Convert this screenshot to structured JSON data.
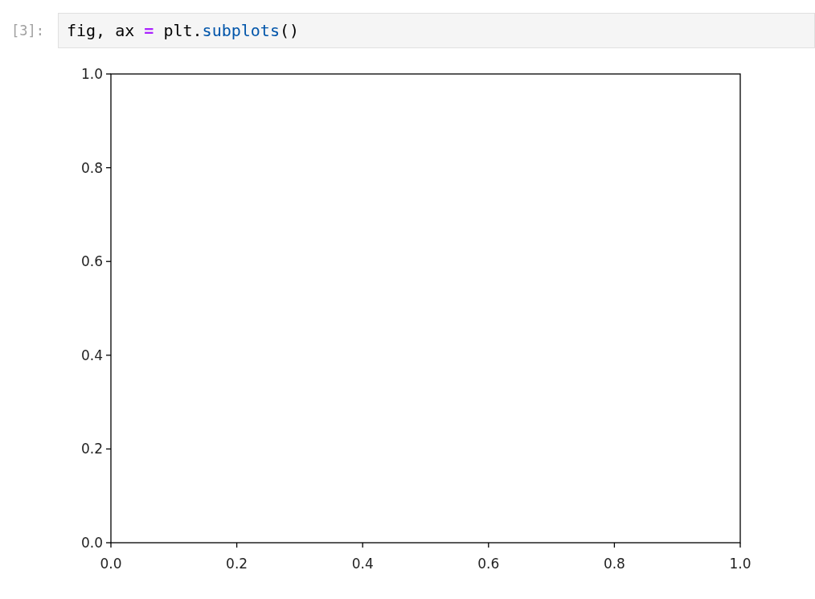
{
  "cell": {
    "prompt": "[3]:",
    "code": [
      {
        "text": "fig, ax ",
        "kind": "plain"
      },
      {
        "text": "=",
        "kind": "operator"
      },
      {
        "text": " plt.",
        "kind": "plain"
      },
      {
        "text": "subplots",
        "kind": "function"
      },
      {
        "text": "()",
        "kind": "plain"
      }
    ]
  },
  "output": {
    "chart_data": {
      "type": "line",
      "xlim": [
        0,
        1
      ],
      "ylim": [
        0,
        1
      ],
      "xticks": [
        {
          "value": 0,
          "label": "0.0"
        },
        {
          "value": 0.2,
          "label": "0.2"
        },
        {
          "value": 0.4,
          "label": "0.4"
        },
        {
          "value": 0.6,
          "label": "0.6"
        },
        {
          "value": 0.8,
          "label": "0.8"
        },
        {
          "value": 1,
          "label": "1.0"
        }
      ],
      "yticks": [
        {
          "value": 0,
          "label": "0.0"
        },
        {
          "value": 0.2,
          "label": "0.2"
        },
        {
          "value": 0.4,
          "label": "0.4"
        },
        {
          "value": 0.6,
          "label": "0.6"
        },
        {
          "value": 0.8,
          "label": "0.8"
        },
        {
          "value": 1,
          "label": "1.0"
        }
      ]
    }
  }
}
